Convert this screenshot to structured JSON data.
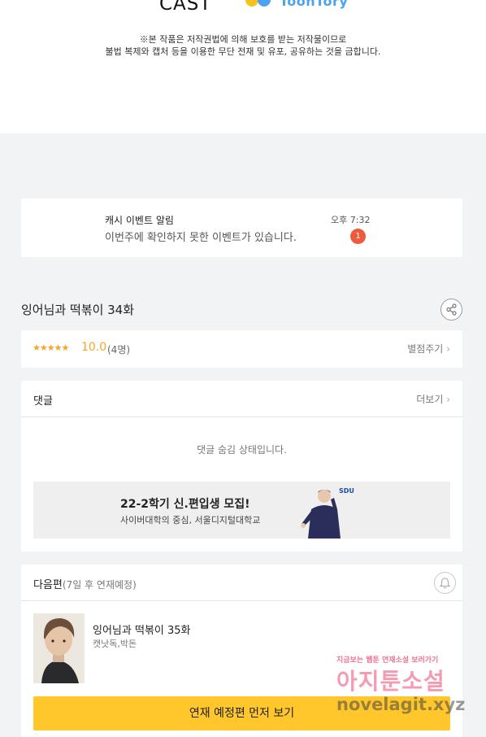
{
  "header": {
    "logo_cast": "CAST",
    "logo_toon": "ToonTory",
    "copyright_line1": "※본 작품은 저작권법에 의해 보호를 받는 저작물이므로",
    "copyright_line2": "불법 복제와 캡처 등을 이용한 무단 전재 및 유포, 공유하는 것을 금합니다."
  },
  "notification": {
    "title": "캐시 이벤트 알림",
    "message": "이번주에 확인하지 못한 이벤트가 있습니다.",
    "time": "오후 7:32",
    "badge_count": "1"
  },
  "episode": {
    "title": "잉어님과 떡볶이 34화"
  },
  "rating": {
    "stars": "★★★★★",
    "score": "10.0",
    "count": "(4명)",
    "rate_label": "별점주기"
  },
  "comments": {
    "label": "댓글",
    "more_label": "더보기",
    "hidden_message": "댓글 숨김 상태입니다."
  },
  "ad_banner": {
    "title": "22-2학기 신.편입생 모집!",
    "subtitle": "사이버대학의 중심, 서울디지털대학교",
    "logo_text": "SDU"
  },
  "next_episode": {
    "label": "다음편",
    "schedule": "(7일 후 연재예정)",
    "title": "잉어님과 떡볶이 35화",
    "authors": "캣낫독,박돈",
    "cta_label": "연재 예정편 먼저 보기"
  },
  "watermark": {
    "line1": "지금보는 웹툰 연재소설 보러가기",
    "line2": "아지툰소설",
    "line3": "novelagit.xyz"
  },
  "colors": {
    "accent_yellow": "#ffc72c",
    "star_orange": "#f5a623",
    "badge_red": "#ee5a3c",
    "background": "#f2f3f5"
  }
}
